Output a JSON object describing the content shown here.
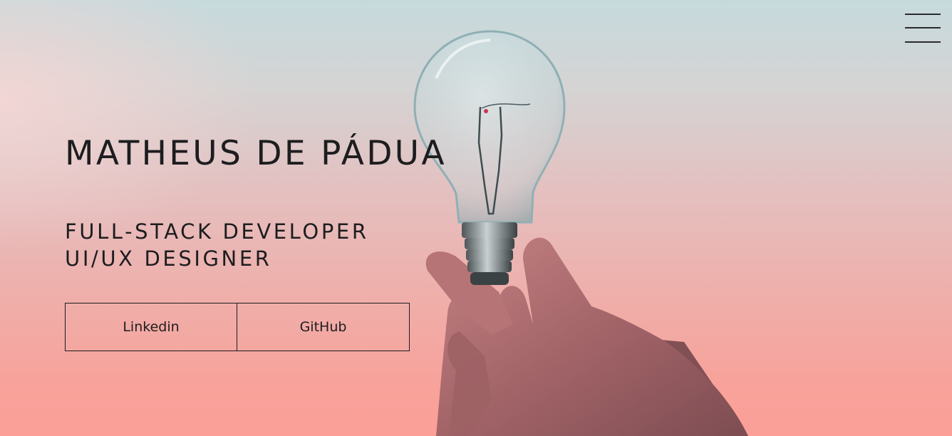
{
  "hero": {
    "name": "MATHEUS DE PÁDUA",
    "roles": [
      "FULL-STACK DEVELOPER",
      "UI/UX DESIGNER"
    ],
    "links": [
      {
        "label": "Linkedin"
      },
      {
        "label": "GitHub"
      }
    ],
    "image": "hand-holding-light-bulb"
  },
  "menu": {
    "icon": "hamburger-menu-icon"
  },
  "colors": {
    "text": "#1d1d1f",
    "background_top": "#c6dadd",
    "background_bottom": "#fb9f97"
  }
}
